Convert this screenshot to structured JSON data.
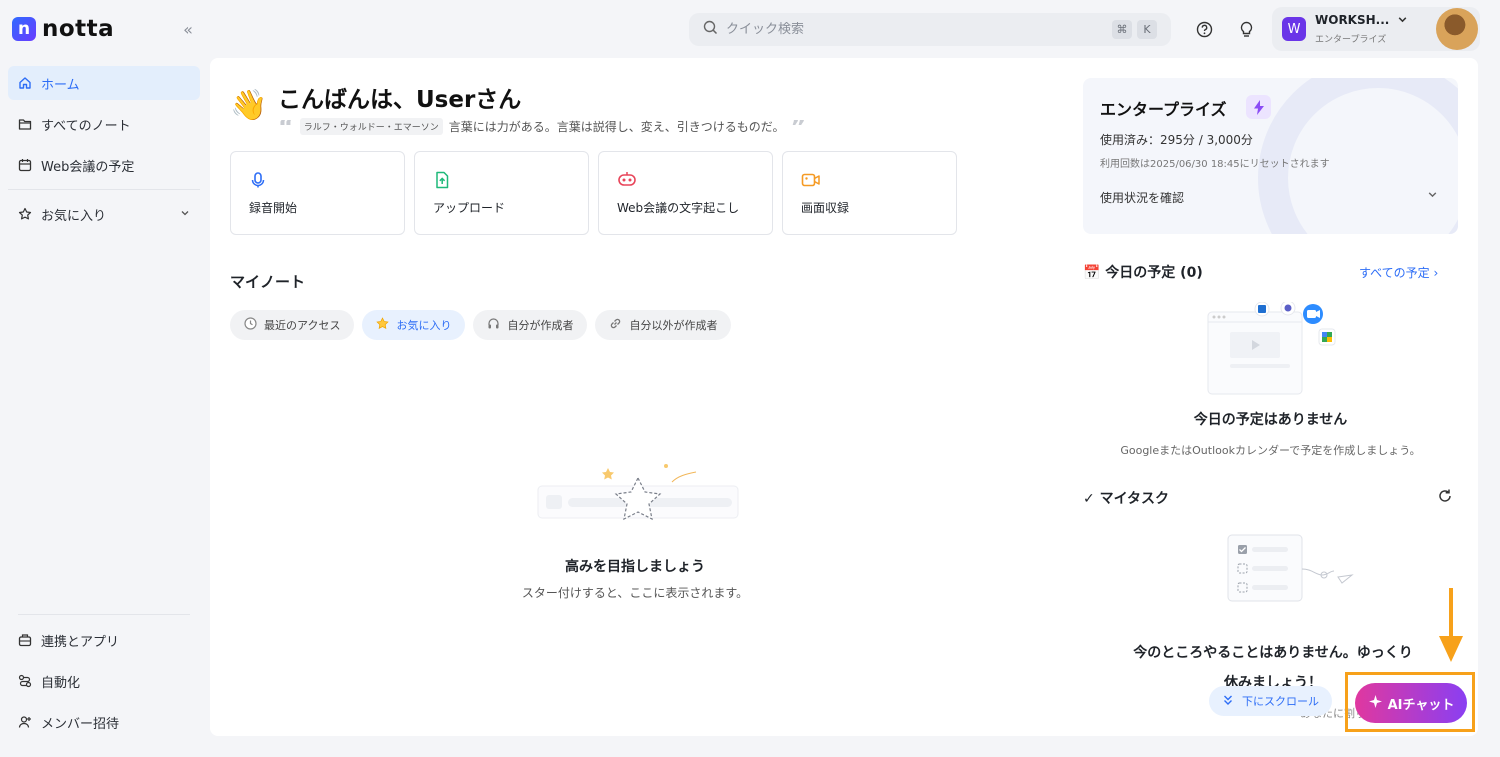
{
  "app": {
    "name": "notta"
  },
  "sidebar": {
    "items": [
      {
        "label": "ホーム",
        "icon": "home-icon"
      },
      {
        "label": "すべてのノート",
        "icon": "folder-icon"
      },
      {
        "label": "Web会議の予定",
        "icon": "calendar-icon"
      }
    ],
    "favorites_label": "お気に入り",
    "bottom_items": [
      {
        "label": "連携とアプリ",
        "icon": "apps-icon"
      },
      {
        "label": "自動化",
        "icon": "automation-icon"
      },
      {
        "label": "メンバー招待",
        "icon": "add-member-icon"
      }
    ]
  },
  "topbar": {
    "search_placeholder": "クイック検索",
    "shortcut_keys": [
      "⌘",
      "K"
    ],
    "workspace_initial": "W",
    "workspace_name": "WORKSH...",
    "workspace_plan": "エンタープライズ"
  },
  "home": {
    "greeting": "こんばんは、Userさん",
    "quote_author": "ラルフ・ウォルドー・エマーソン",
    "quote_text": "言葉には力がある。言葉は説得し、変え、引きつけるものだ。",
    "actions": [
      {
        "label": "録音開始",
        "icon": "mic-icon",
        "color": "#2d6df6"
      },
      {
        "label": "アップロード",
        "icon": "upload-icon",
        "color": "#1fb97a"
      },
      {
        "label": "Web会議の文字起こし",
        "icon": "meeting-bot-icon",
        "color": "#e8455a"
      },
      {
        "label": "画面収録",
        "icon": "screen-record-icon",
        "color": "#f59a23"
      }
    ],
    "my_notes_title": "マイノート",
    "filters": [
      {
        "label": "最近のアクセス",
        "icon": "clock-icon"
      },
      {
        "label": "お気に入り",
        "icon": "star-icon"
      },
      {
        "label": "自分が作成者",
        "icon": "headset-icon"
      },
      {
        "label": "自分以外が作成者",
        "icon": "link-icon"
      }
    ],
    "empty_title": "高みを目指しましょう",
    "empty_sub": "スター付けすると、ここに表示されます。"
  },
  "plan": {
    "title": "エンタープライズ",
    "usage": "使用済み：295分 / 3,000分",
    "reset": "利用回数は2025/06/30 18:45にリセットされます",
    "check_label": "使用状況を確認"
  },
  "schedule": {
    "title": "📅 今日の予定 (0)",
    "all_link": "すべての予定",
    "empty_title": "今日の予定はありません",
    "empty_sub": "GoogleまたはOutlookカレンダーで予定を作成しましょう。"
  },
  "tasks": {
    "title": "マイタスク",
    "empty_line1": "今のところやることはありません。ゆっくり",
    "empty_line2": "休みましょう！",
    "cut_text": "あなたに割り当"
  },
  "floating": {
    "scroll_label": "下にスクロール",
    "ai_chat_label": "AIチャット"
  },
  "colors": {
    "accent": "#2d6df6",
    "highlight": "#f7a11a"
  }
}
